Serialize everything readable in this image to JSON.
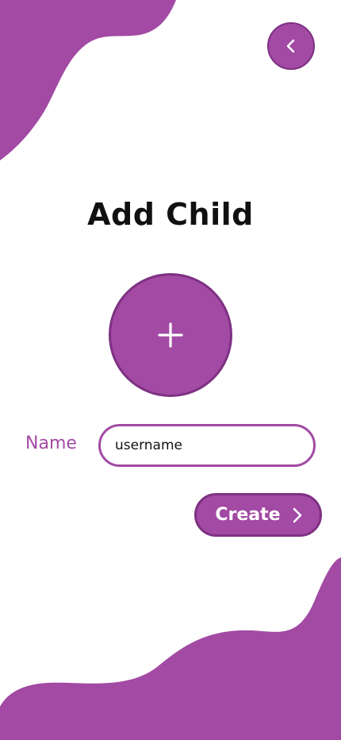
{
  "screen": {
    "title": "Add Child"
  },
  "header": {
    "back_icon": "chevron-left-icon"
  },
  "photo": {
    "icon": "plus-icon"
  },
  "form": {
    "name_label": "Name",
    "name_value": "",
    "name_placeholder": "username"
  },
  "actions": {
    "create_label": "Create",
    "create_icon": "chevron-right-icon"
  },
  "colors": {
    "accent": "#a24aa4",
    "accent_dark": "#7e3183",
    "text": "#111111",
    "background": "#ffffff"
  }
}
